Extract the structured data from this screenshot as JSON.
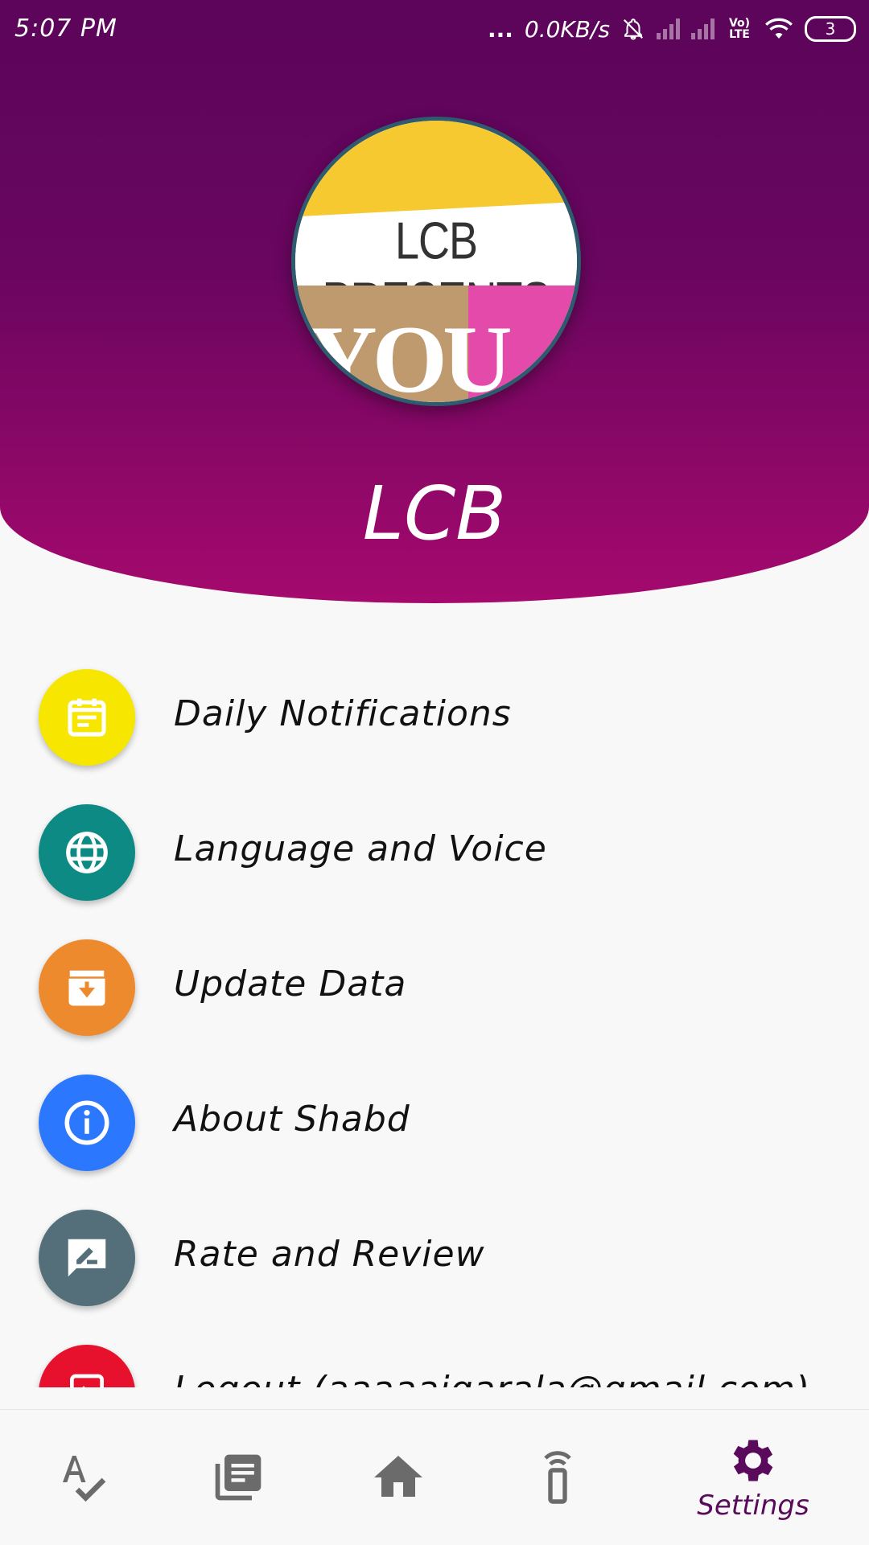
{
  "status_bar": {
    "time": "5:07 PM",
    "dots": "...",
    "speed": "0.0KB/s",
    "network": "Vo) LTE",
    "battery": "3"
  },
  "profile": {
    "name": "LCB",
    "avatar_text": "LCB PRESENTS",
    "avatar_big_text": "YOU V"
  },
  "menu": {
    "items": [
      {
        "label": "Daily Notifications",
        "icon": "calendar-icon",
        "color": "#f7e600"
      },
      {
        "label": "Language and Voice",
        "icon": "globe-icon",
        "color": "#0d8a83"
      },
      {
        "label": "Update Data",
        "icon": "archive-download-icon",
        "color": "#ee8a2e"
      },
      {
        "label": "About Shabd",
        "icon": "info-icon",
        "color": "#2b78ff"
      },
      {
        "label": "Rate and Review",
        "icon": "rate-review-icon",
        "color": "#546e7a"
      },
      {
        "label": "Logout (aaaaaigarala@gmail.com)",
        "icon": "logout-icon",
        "color": "#e8112d"
      }
    ]
  },
  "bottom_nav": {
    "items": [
      {
        "name": "spellcheck",
        "icon": "spellcheck-icon"
      },
      {
        "name": "library",
        "icon": "library-books-icon"
      },
      {
        "name": "home",
        "icon": "home-icon"
      },
      {
        "name": "remote",
        "icon": "remote-icon"
      },
      {
        "name": "settings",
        "icon": "gear-icon",
        "label": "Settings",
        "active": true
      }
    ]
  },
  "colors": {
    "header_top": "#5b055a",
    "header_bottom": "#a5096d",
    "active_nav": "#5a0a5a",
    "inactive_nav": "#6b6b6b"
  }
}
